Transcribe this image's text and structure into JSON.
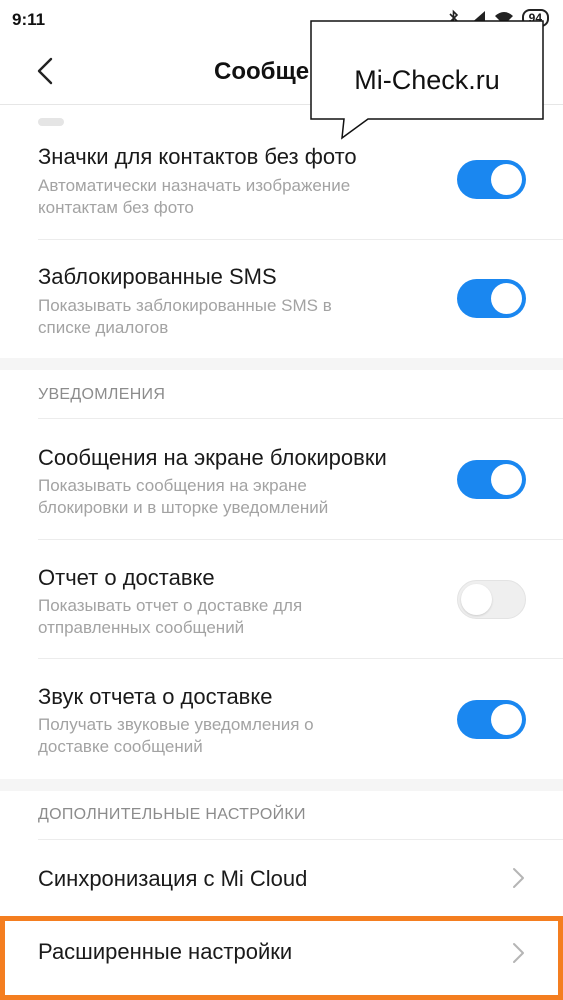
{
  "status": {
    "time": "9:11",
    "battery": "94"
  },
  "header": {
    "title": "Сообщения"
  },
  "callout": {
    "text": "Mi-Check.ru"
  },
  "settings": {
    "contact_icons": {
      "title": "Значки для контактов без фото",
      "sub1": "Автоматически назначать изображение",
      "sub2": "контактам без фото",
      "enabled": true
    },
    "blocked_sms": {
      "title": "Заблокированные SMS",
      "sub1": "Показывать заблокированные SMS в",
      "sub2": "списке диалогов",
      "enabled": true
    }
  },
  "notifications": {
    "section_label": "УВЕДОМЛЕНИЯ",
    "lockscreen": {
      "title": "Сообщения на экране блокировки",
      "sub1": "Показывать сообщения на экране",
      "sub2": "блокировки и в шторке уведомлений",
      "enabled": true
    },
    "delivery_report": {
      "title": "Отчет о доставке",
      "sub1": "Показывать отчет о доставке для",
      "sub2": "отправленных сообщений",
      "enabled": false
    },
    "delivery_sound": {
      "title": "Звук отчета о доставке",
      "sub1": "Получать звуковые уведомления о",
      "sub2": "доставке сообщений",
      "enabled": true
    }
  },
  "additional": {
    "section_label": "ДОПОЛНИТЕЛЬНЫЕ НАСТРОЙКИ",
    "mi_cloud": {
      "title": "Синхронизация с Mi Cloud"
    },
    "advanced": {
      "title": "Расширенные настройки"
    }
  },
  "colors": {
    "accent": "#1a87f0",
    "highlight": "#f47e20",
    "subtext": "#a3a3a3"
  }
}
